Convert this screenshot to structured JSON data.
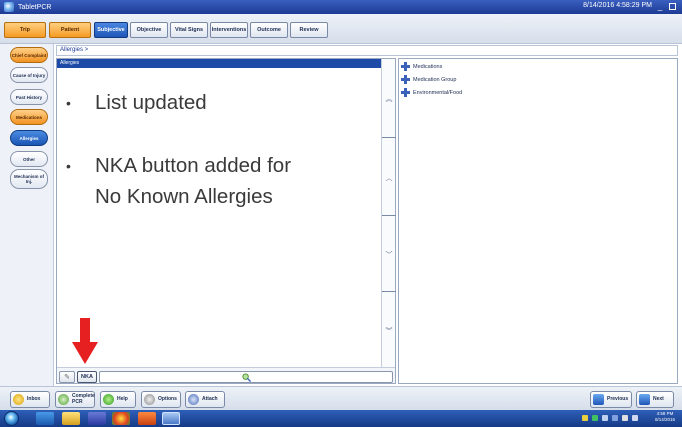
{
  "window": {
    "title": "TabletPCR",
    "datetime": "8/14/2016 4:58:29 PM",
    "minimize_icon": "minimize-icon",
    "restore_icon": "restore-icon"
  },
  "top_tabs": [
    {
      "label": "Trip",
      "style": "orange"
    },
    {
      "label": "Patient",
      "style": "orange"
    },
    {
      "label": "Subjective",
      "style": "active"
    },
    {
      "label": "Objective",
      "style": "normal"
    },
    {
      "label": "Vital Signs",
      "style": "normal"
    },
    {
      "label": "Interventions",
      "style": "normal"
    },
    {
      "label": "Outcome",
      "style": "normal"
    },
    {
      "label": "Review",
      "style": "normal"
    }
  ],
  "left_nav": [
    {
      "label": "Chief Complaint",
      "style": "orange"
    },
    {
      "label": "Cause of Injury",
      "style": "normal"
    },
    {
      "label": "Past History",
      "style": "normal"
    },
    {
      "label": "Medications",
      "style": "orange"
    },
    {
      "label": "Allergies",
      "style": "active"
    },
    {
      "label": "Other",
      "style": "normal"
    },
    {
      "label": "Mechanism of Inj.",
      "style": "normal"
    }
  ],
  "breadcrumb": "Allergies >",
  "left_panel": {
    "header": "Allergies",
    "scroll_icons": [
      "double-up-chevron-icon",
      "up-chevron-icon",
      "down-chevron-icon",
      "double-down-chevron-icon"
    ],
    "scroll_glyphs": [
      "︽",
      "︿",
      "﹀",
      "︾"
    ]
  },
  "overlay_text": {
    "bullet1": "List updated",
    "bullet2_line1": "NKA button added for",
    "bullet2_line2": "No Known Allergies",
    "bullet_char": "•"
  },
  "bottom_strip": {
    "pencil_icon": "pencil-icon",
    "nka_label": "NKA",
    "search_icon": "search-icon"
  },
  "right_panel": {
    "tree": [
      "Medications",
      "Medication Group",
      "Environmental/Food"
    ]
  },
  "bottom_toolbar": {
    "inbox": "Inbox",
    "complete_pcr_1": "Complete",
    "complete_pcr_2": "PCR",
    "help": "Help",
    "options": "Options",
    "attach": "Attach",
    "previous": "Previous",
    "next": "Next"
  },
  "taskbar": {
    "time": "4:58 PM",
    "date": "8/14/2016"
  },
  "colors": {
    "accent_blue": "#1c4aa6",
    "orange": "#f59b24",
    "arrow_red": "#e62020"
  }
}
